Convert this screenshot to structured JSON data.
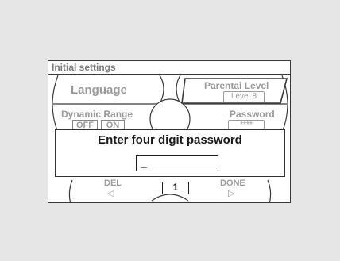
{
  "screen": {
    "title": "Initial settings",
    "menu": {
      "language": "Language",
      "parental_level": {
        "label": "Parental Level",
        "value": "Level 8"
      },
      "dynamic_range": {
        "label": "Dynamic Range",
        "options": [
          "OFF",
          "ON"
        ]
      },
      "password": {
        "label": "Password",
        "value": "****"
      }
    },
    "dialog": {
      "prompt": "Enter four digit password",
      "input_value": "_"
    },
    "bottom": {
      "del_label": "DEL",
      "del_icon": "left-triangle-icon",
      "done_label": "DONE",
      "done_icon": "right-triangle-icon",
      "digit": "1"
    }
  }
}
